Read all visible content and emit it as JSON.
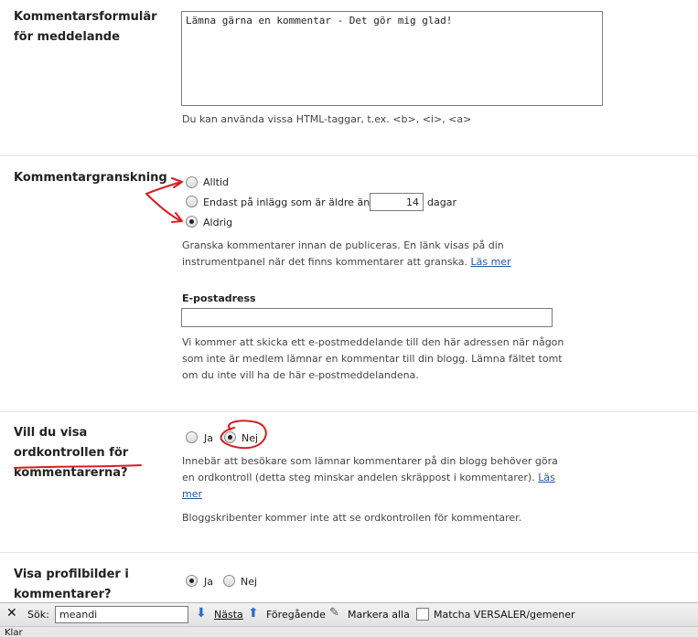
{
  "comment_form": {
    "label": "Kommentarsformulär för meddelande",
    "textarea_value": "Lämna gärna en kommentar - Det gör mig glad!",
    "hint": "Du kan använda vissa HTML-taggar, t.ex. <b>, <i>, <a>"
  },
  "moderation": {
    "label": "Kommentargranskning",
    "options": [
      {
        "label": "Alltid",
        "selected": false
      },
      {
        "label": "Endast på inlägg som är äldre än",
        "selected": false,
        "days_value": "14",
        "suffix": "dagar"
      },
      {
        "label": "Aldrig",
        "selected": true
      }
    ],
    "hint": "Granska kommentarer innan de publiceras. En länk visas på din instrumentpanel när det finns kommentarer att granska.",
    "learn_more": "Läs mer",
    "email_label": "E-postadress",
    "email_value": "",
    "email_hint": "Vi kommer att skicka ett e-postmeddelande till den här adressen när någon som inte är medlem lämnar en kommentar till din blogg. Lämna fältet tomt om du inte vill ha de här e-postmeddelandena."
  },
  "word_verification": {
    "label": "Vill du visa ordkontrollen för kommentarerna?",
    "yes_label": "Ja",
    "no_label": "Nej",
    "selected": "Nej",
    "hint": "Innebär att besökare som lämnar kommentarer på din blogg behöver göra en ordkontroll (detta steg minskar andelen skräppost i kommentarer).",
    "learn_more": "Läs mer",
    "hint2": "Bloggskribenter kommer inte att se ordkontrollen för kommentarer."
  },
  "profile_images": {
    "label": "Visa profilbilder i kommentarer?",
    "yes_label": "Ja",
    "no_label": "Nej",
    "selected": "Ja"
  },
  "findbar": {
    "close_icon": "close-icon",
    "search_label": "Sök:",
    "search_value": "meandi",
    "next_label": "Nästa",
    "prev_label": "Föregående",
    "highlight_label": "Markera alla",
    "match_case_label": "Matcha VERSALER/gemener",
    "match_case_checked": false
  },
  "status": {
    "text": "Klar"
  },
  "colors": {
    "annotation_red": "#d42020",
    "link": "#2255aa"
  }
}
